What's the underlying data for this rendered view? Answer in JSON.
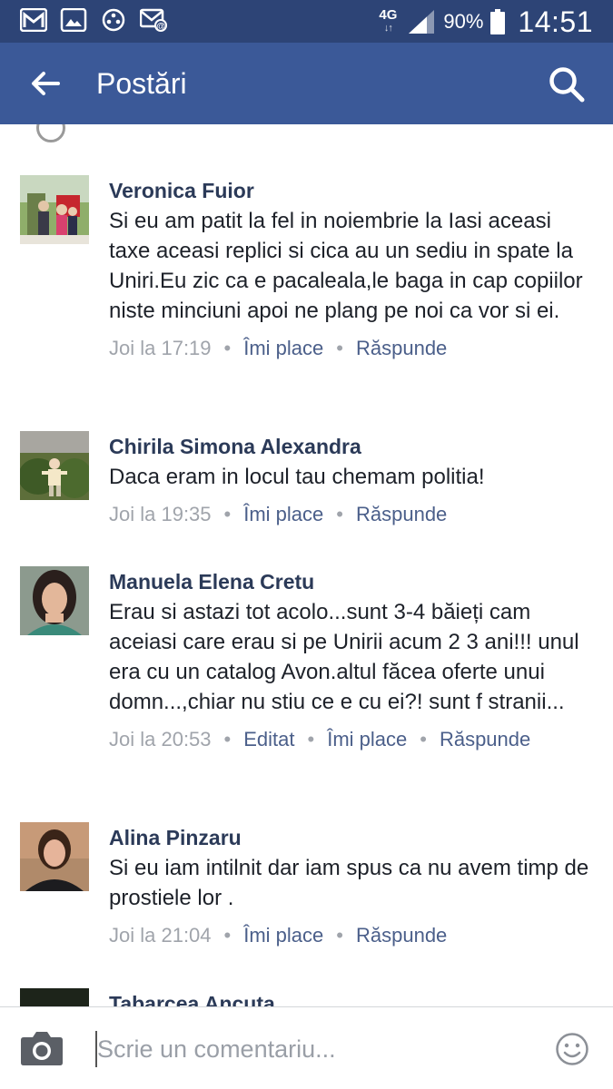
{
  "status_bar": {
    "network": "4G",
    "network_arrows": "↓↑",
    "battery": "90%",
    "time": "14:51",
    "notification_icons": [
      "gmail-icon",
      "gallery-icon",
      "game-icon",
      "email-sync-icon"
    ]
  },
  "app_bar": {
    "title": "Postări",
    "back_icon": "arrow-left-icon",
    "search_icon": "search-icon"
  },
  "comments": [
    {
      "name": "Veronica Fuior",
      "text": "Si eu am patit la fel in noiembrie la Iasi aceasi taxe aceasi replici si cica au un sediu in spate la Uniri.Eu zic ca e pacaleala,le baga in cap copiilor niste minciuni apoi ne plang pe noi ca vor si ei.",
      "time": "Joi la 17:19",
      "like": "Îmi place",
      "reply": "Răspunde"
    },
    {
      "name": "Chirila Simona Alexandra",
      "text": "Daca eram in locul tau chemam politia!",
      "time": "Joi la 19:35",
      "like": "Îmi place",
      "reply": "Răspunde"
    },
    {
      "name": "Manuela Elena Cretu",
      "text": "Erau si astazi tot acolo...sunt 3-4 băieți cam aceiasi care erau si pe Unirii acum 2 3 ani!!! unul era cu un catalog  Avon.altul  făcea oferte unui domn...,chiar nu stiu  ce e cu ei?! sunt f stranii...",
      "time": "Joi la 20:53",
      "edited": "Editat",
      "like": "Îmi place",
      "reply": "Răspunde"
    },
    {
      "name": "Alina Pinzaru",
      "text": "Si eu iam intilnit dar iam spus ca nu avem timp de prostiele lor .",
      "time": "Joi la 21:04",
      "like": "Îmi place",
      "reply": "Răspunde"
    },
    {
      "name": "Tabarcea Ancuta"
    }
  ],
  "composer": {
    "placeholder": "Scrie un comentariu...",
    "camera_icon": "camera-icon",
    "emoji_icon": "emoji-icon"
  },
  "colors": {
    "status_bar": "#2d4476",
    "app_bar": "#3b5998",
    "name": "#2b3a58",
    "meta": "#a0a4ab",
    "action": "#4b5f8a"
  }
}
